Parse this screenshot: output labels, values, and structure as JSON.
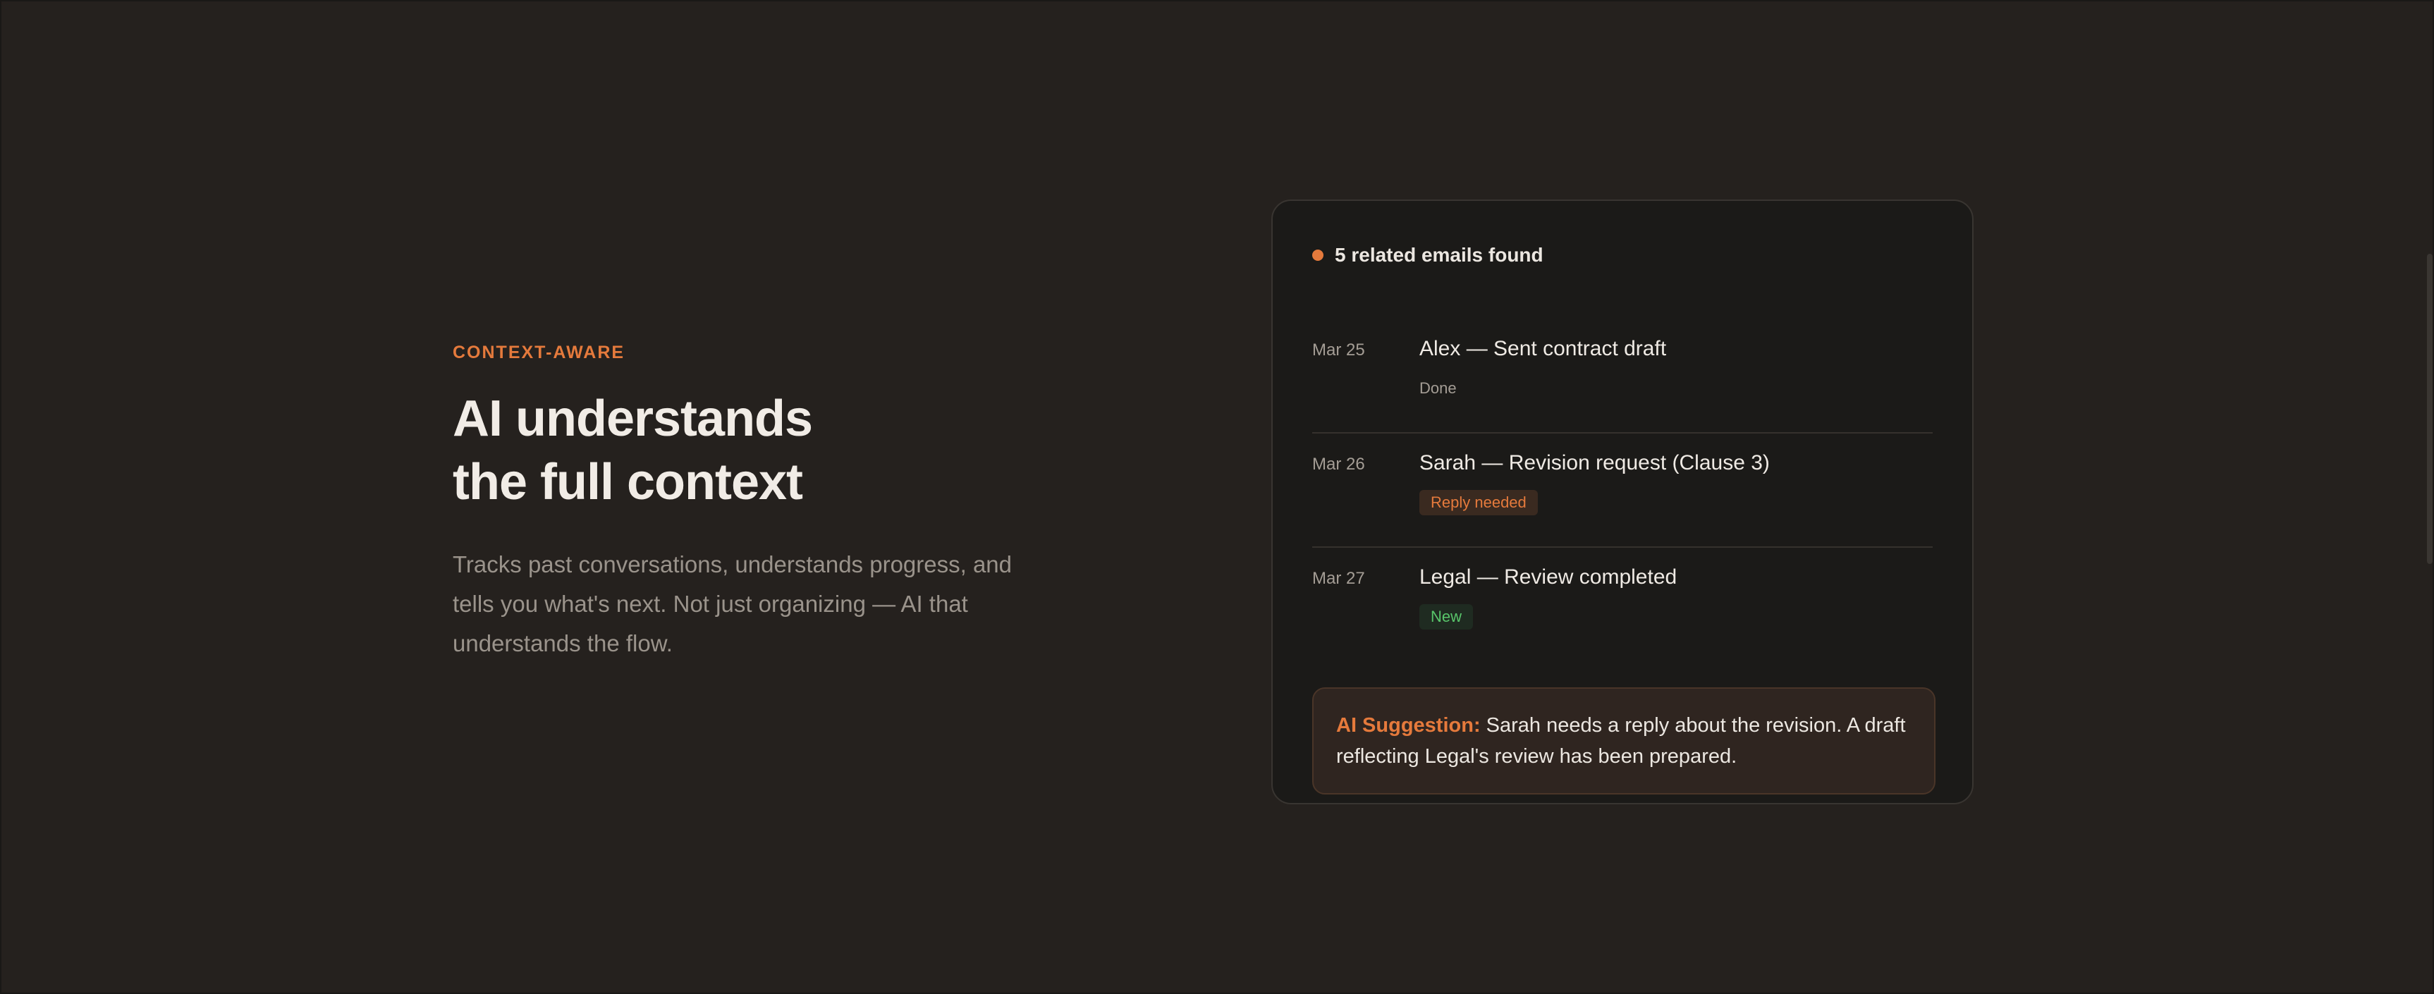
{
  "section": {
    "eyebrow": "CONTEXT-AWARE",
    "headline_line1": "AI understands",
    "headline_line2": "the full context",
    "description": "Tracks past conversations, understands progress, and tells you what's next. Not just organizing — AI that understands the flow."
  },
  "card": {
    "header": "5 related emails found",
    "status_color": "#e57a3c",
    "emails": [
      {
        "date": "Mar 25",
        "subject": "Alex — Sent contract draft",
        "tag": "Done"
      },
      {
        "date": "Mar 26",
        "subject": "Sarah — Revision request (Clause 3)",
        "tag": "Reply needed"
      },
      {
        "date": "Mar 27",
        "subject": "Legal — Review completed",
        "tag": "New"
      }
    ],
    "suggestion": {
      "label": "AI Suggestion:",
      "text": " Sarah needs a reply about the revision. A draft reflecting Legal's review has been prepared."
    }
  },
  "colors": {
    "background": "#25211e",
    "accent": "#e57a3c",
    "success": "#58c56a",
    "card": "#1b1a18"
  }
}
